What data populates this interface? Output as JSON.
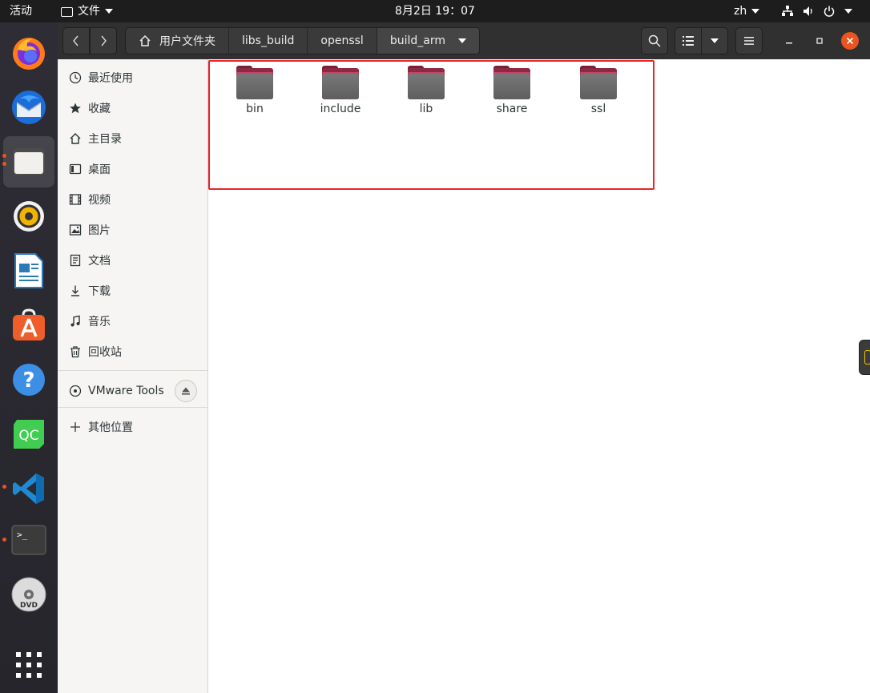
{
  "topbar": {
    "activities": "活动",
    "app_menu": "文件",
    "clock": "8月2日 19：07",
    "lang": "zh",
    "tray_icons": [
      "network-icon",
      "volume-icon",
      "power-icon",
      "chevron-down-icon"
    ]
  },
  "dock": {
    "apps": [
      {
        "name": "firefox",
        "running": false
      },
      {
        "name": "thunderbird",
        "running": false
      },
      {
        "name": "files",
        "running": true,
        "active": true
      },
      {
        "name": "rhythmbox",
        "running": false
      },
      {
        "name": "libreoffice-writer",
        "running": false
      },
      {
        "name": "ubuntu-software",
        "running": false
      },
      {
        "name": "help",
        "running": false
      },
      {
        "name": "qt-creator",
        "running": false
      },
      {
        "name": "vscode",
        "running": true
      },
      {
        "name": "terminal",
        "running": true
      },
      {
        "name": "dvd",
        "running": false
      },
      {
        "name": "show-applications",
        "running": false
      }
    ],
    "accent": "#e95420"
  },
  "headerbar": {
    "path": [
      {
        "label": "用户文件夹",
        "icon": "home-icon"
      },
      {
        "label": "libs_build"
      },
      {
        "label": "openssl"
      },
      {
        "label": "build_arm",
        "current": true
      }
    ]
  },
  "sidebar": {
    "items": [
      {
        "label": "最近使用",
        "icon": "clock-icon"
      },
      {
        "label": "收藏",
        "icon": "star-icon"
      },
      {
        "label": "主目录",
        "icon": "home-icon"
      },
      {
        "label": "桌面",
        "icon": "desktop-icon"
      },
      {
        "label": "视频",
        "icon": "video-icon"
      },
      {
        "label": "图片",
        "icon": "image-icon"
      },
      {
        "label": "文档",
        "icon": "document-icon"
      },
      {
        "label": "下载",
        "icon": "download-icon"
      },
      {
        "label": "音乐",
        "icon": "music-icon"
      },
      {
        "label": "回收站",
        "icon": "trash-icon"
      }
    ],
    "device": {
      "label": "VMware Tools",
      "icon": "disc-icon"
    },
    "other": {
      "label": "其他位置",
      "icon": "plus-icon"
    }
  },
  "content": {
    "files": [
      {
        "name": "bin",
        "type": "folder"
      },
      {
        "name": "include",
        "type": "folder"
      },
      {
        "name": "lib",
        "type": "folder"
      },
      {
        "name": "share",
        "type": "folder"
      },
      {
        "name": "ssl",
        "type": "folder"
      }
    ],
    "highlight_color": "#e8242b"
  }
}
